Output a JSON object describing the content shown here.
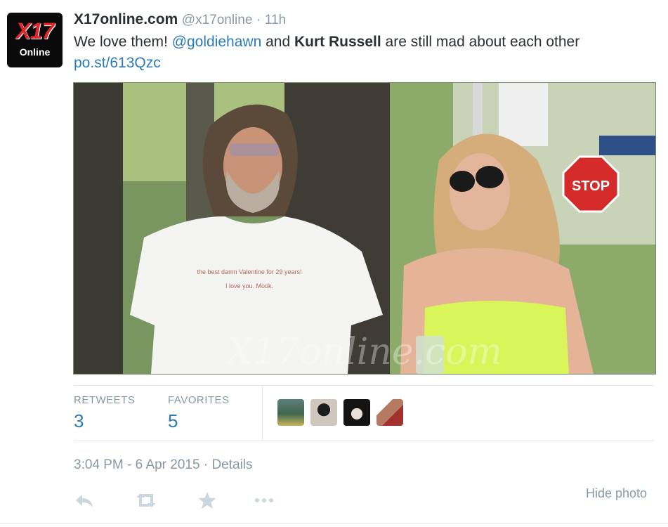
{
  "colors": {
    "link": "#2b7bb9",
    "muted": "#8899a6",
    "text": "#292f33",
    "brand_red": "#e0262b"
  },
  "avatar": {
    "logo_top": "X17",
    "logo_bottom": "Online",
    "icon": "x17-online-logo-icon"
  },
  "tweet": {
    "display_name": "X17online.com",
    "handle": "@x17online",
    "separator": "·",
    "age": "11h",
    "text_before": "We love them!",
    "mention": "@goldiehawn",
    "text_and": "and",
    "bold_name": "Kurt Russell",
    "text_after": "are still mad about each other",
    "link": "po.st/613Qzc",
    "photo_shirt_line1": "the best damn Valentine for 29 years!",
    "photo_shirt_line2": "I love you. Mook.",
    "photo_sign": "STOP",
    "photo_watermark": "X17online.com"
  },
  "stats": {
    "retweets_label": "RETWEETS",
    "retweets_value": "3",
    "favorites_label": "FAVORITES",
    "favorites_value": "5"
  },
  "footer": {
    "timestamp": "3:04 PM - 6 Apr 2015",
    "separator": "·",
    "details": "Details",
    "hide_photo": "Hide photo"
  },
  "actions": [
    "reply-icon",
    "retweet-icon",
    "favorite-star-icon",
    "more-dots-icon"
  ]
}
